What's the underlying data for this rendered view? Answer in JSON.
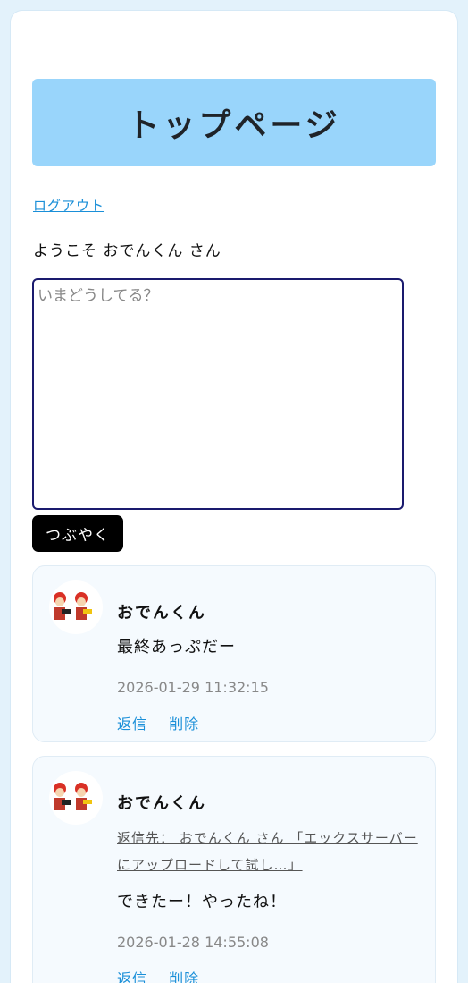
{
  "header": {
    "title": "トップページ"
  },
  "nav": {
    "logout": "ログアウト"
  },
  "welcome": "ようこそ おでんくん さん",
  "compose": {
    "placeholder": "いまどうしてる？",
    "value": "",
    "submit": "つぶやく"
  },
  "posts": [
    {
      "user": "おでんくん",
      "content": "最終あっぷだー",
      "time": "2026-01-29 11:32:15",
      "reply": "返信",
      "delete": "削除"
    },
    {
      "user": "おでんくん",
      "reply_to": "返信先： おでんくん さん 「エックスサーバーにアップロードして試し…」",
      "content": "できたー！やったね！",
      "time": "2026-01-28 14:55:08",
      "reply": "返信",
      "delete": "削除"
    }
  ],
  "colors": {
    "background": "#e3f2fb",
    "header": "#99d5fb",
    "link": "#1a8fd8",
    "button": "#000000"
  }
}
